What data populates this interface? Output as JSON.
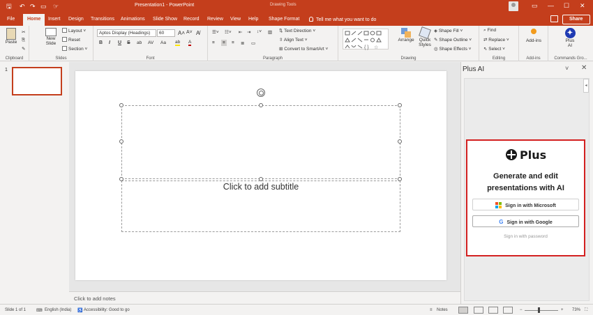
{
  "titlebar": {
    "title": "Presentation1 - PowerPoint",
    "contextual_label": "Drawing Tools",
    "qa_icons": [
      "save-icon",
      "undo-icon",
      "redo-icon",
      "present-icon",
      "touch-mode-icon"
    ]
  },
  "tabs": [
    {
      "label": "File"
    },
    {
      "label": "Home"
    },
    {
      "label": "Insert"
    },
    {
      "label": "Design"
    },
    {
      "label": "Transitions"
    },
    {
      "label": "Animations"
    },
    {
      "label": "Slide Show"
    },
    {
      "label": "Record"
    },
    {
      "label": "Review"
    },
    {
      "label": "View"
    },
    {
      "label": "Help"
    },
    {
      "label": "Shape Format"
    }
  ],
  "active_tab": "Home",
  "tell_me": "Tell me what you want to do",
  "share_label": "Share",
  "ribbon": {
    "clipboard": {
      "paste": "Paste",
      "label": "Clipboard"
    },
    "slides": {
      "new_slide": "New",
      "new_slide2": "Slide",
      "layout": "Layout",
      "reset": "Reset",
      "section": "Section",
      "label": "Slides"
    },
    "font": {
      "face": "Aptos Display (Headings)",
      "size": "60",
      "bold": "B",
      "italic": "I",
      "underline": "U",
      "strike": "S",
      "label": "Font"
    },
    "paragraph": {
      "text_direction": "Text Direction",
      "align_text": "Align Text",
      "convert_smartart": "Convert to SmartArt",
      "label": "Paragraph"
    },
    "drawing": {
      "arrange": "Arrange",
      "quick_styles": "Quick",
      "quick_styles2": "Styles",
      "shape_fill": "Shape Fill",
      "shape_outline": "Shape Outline",
      "shape_effects": "Shape Effects",
      "label": "Drawing"
    },
    "editing": {
      "find": "Find",
      "replace": "Replace",
      "select": "Select",
      "label": "Editing"
    },
    "addins": {
      "addins": "Add-ins",
      "label": "Add-ins"
    },
    "commands": {
      "plus1": "Plus",
      "plus2": "AI",
      "label": "Commands Gro..."
    }
  },
  "thumbnails": {
    "number": "1"
  },
  "slide": {
    "subtitle_placeholder": "Click to add subtitle"
  },
  "notes_placeholder": "Click to add notes",
  "pane": {
    "title": "Plus AI",
    "logo": "Plus",
    "heading_line1": "Generate and edit",
    "heading_line2": "presentations with AI",
    "btn_microsoft": "Sign in with Microsoft",
    "btn_google": "Sign in with Google",
    "link_password": "Sign in with password"
  },
  "status": {
    "slide": "Slide 1 of 1",
    "language": "English (India)",
    "accessibility": "Accessibility: Good to go",
    "notes": "Notes",
    "zoom": "73%"
  },
  "colors": {
    "brand": "#c43e1c",
    "highlight": "#d32020"
  }
}
